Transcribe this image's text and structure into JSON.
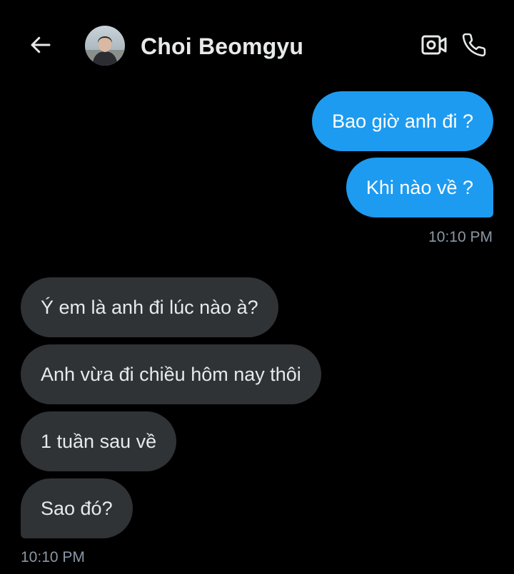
{
  "header": {
    "contact_name": "Choi Beomgyu",
    "icons": [
      "back-arrow-icon",
      "video-call-icon",
      "phone-call-icon"
    ]
  },
  "messages": [
    {
      "side": "sent",
      "text": "Bao giờ anh đi ?"
    },
    {
      "side": "sent",
      "text": "Khi nào về ?"
    },
    {
      "side": "received",
      "text": "Ý em là anh đi lúc nào à?"
    },
    {
      "side": "received",
      "text": "Anh vừa đi chiều hôm nay thôi"
    },
    {
      "side": "received",
      "text": "1 tuần sau về"
    },
    {
      "side": "received",
      "text": "Sao đó?"
    }
  ],
  "timestamps": {
    "sent_group": "10:10 PM",
    "received_group": "10:10 PM"
  },
  "colors": {
    "background": "#000000",
    "sent_bubble": "#1d9bf0",
    "received_bubble": "#2f3336",
    "timestamp": "#8b98a5"
  }
}
